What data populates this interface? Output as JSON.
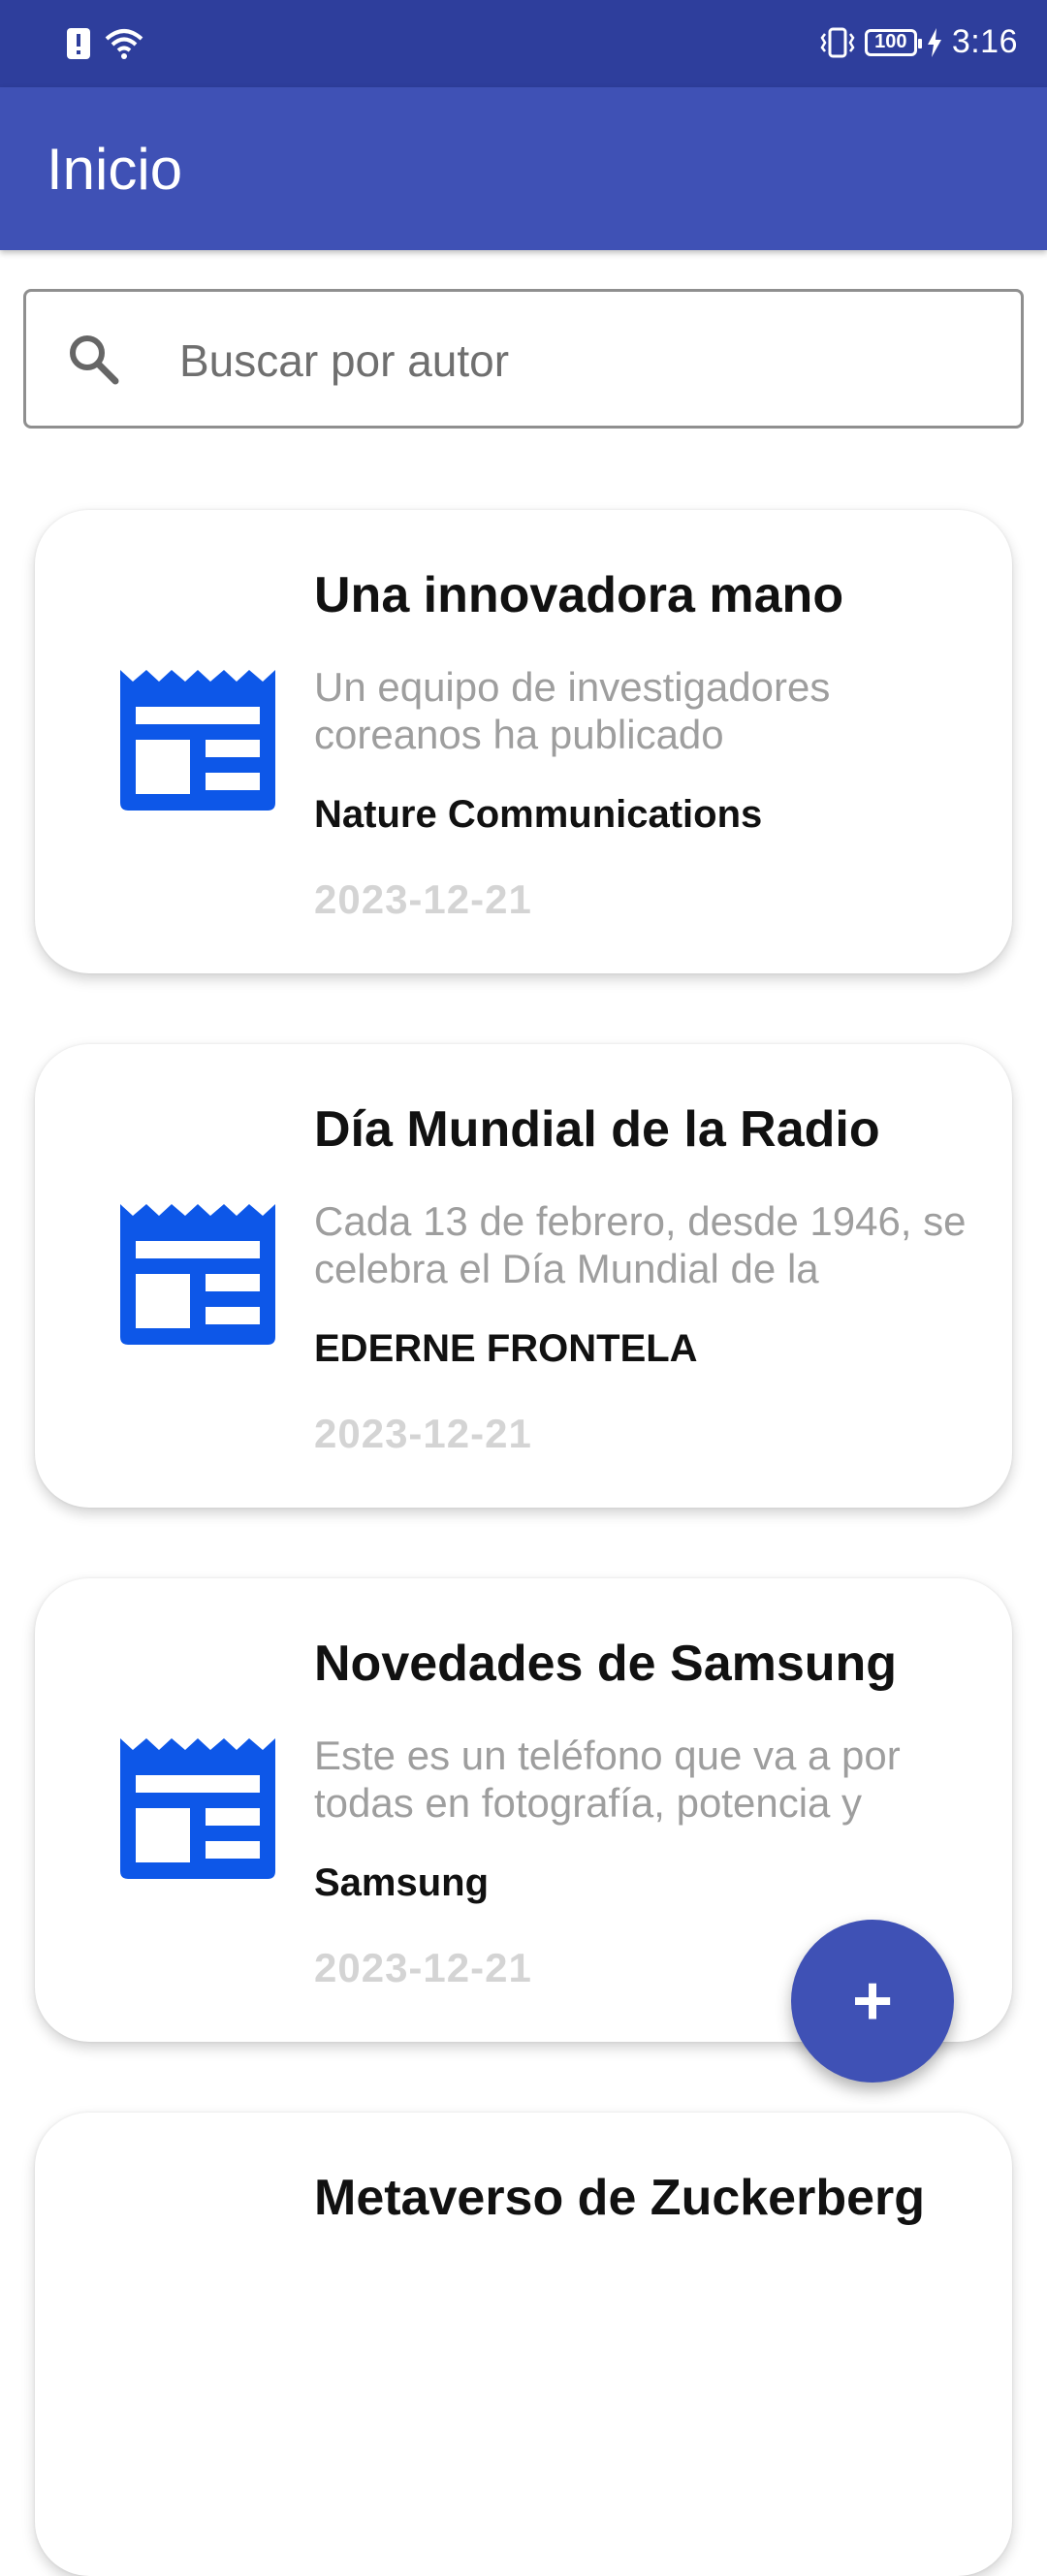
{
  "status_bar": {
    "time": "3:16",
    "battery": "100"
  },
  "app_bar": {
    "title": "Inicio"
  },
  "search": {
    "placeholder": "Buscar por autor",
    "value": ""
  },
  "news": [
    {
      "title": "Una innovadora mano",
      "description": "Un equipo de investigadores coreanos ha publicado",
      "author": "Nature Communications",
      "date": "2023-12-21"
    },
    {
      "title": "Día Mundial de la Radio",
      "description": "Cada 13 de febrero, desde 1946, se celebra el Día Mundial de la",
      "author": "EDERNE FRONTELA",
      "date": "2023-12-21"
    },
    {
      "title": "Novedades de Samsung",
      "description": "Este es un teléfono que va a por todas en fotografía, potencia y",
      "author": "Samsung",
      "date": "2023-12-21"
    },
    {
      "title": "Metaverso de Zuckerberg",
      "description": "",
      "author": "",
      "date": ""
    }
  ],
  "fab": {
    "label": "+"
  },
  "colors": {
    "status_bar": "#2e3e9c",
    "primary": "#3f51b5",
    "news_icon": "#0d57e8"
  }
}
